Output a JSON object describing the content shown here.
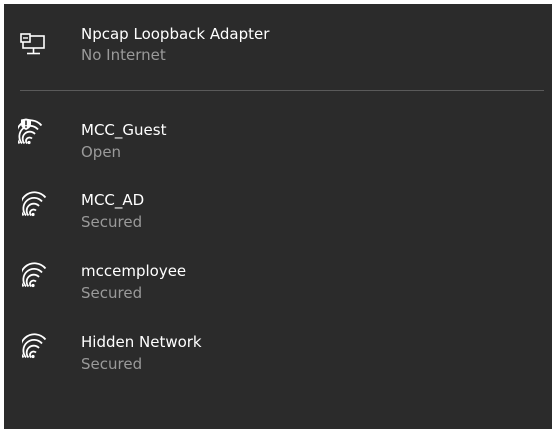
{
  "colors": {
    "background": "#2b2b2b",
    "primary_text": "#ffffff",
    "secondary_text": "#9a9a9a",
    "divider": "#5a5a5a"
  },
  "adapter": {
    "name": "Npcap Loopback Adapter",
    "status": "No Internet",
    "icon": "ethernet-monitor-icon"
  },
  "networks": [
    {
      "name": "MCC_Guest",
      "status": "Open",
      "icon": "wifi-shield-warning-icon"
    },
    {
      "name": "MCC_AD",
      "status": "Secured",
      "icon": "wifi-secured-icon"
    },
    {
      "name": "mccemployee",
      "status": "Secured",
      "icon": "wifi-secured-icon"
    },
    {
      "name": "Hidden Network",
      "status": "Secured",
      "icon": "wifi-secured-icon"
    }
  ]
}
